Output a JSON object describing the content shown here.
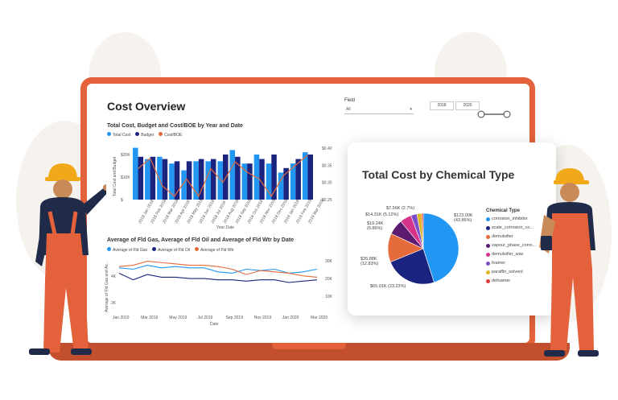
{
  "dashboard": {
    "title": "Cost Overview",
    "filter": {
      "label": "Field",
      "value": "All"
    },
    "year_range": {
      "start": "2018",
      "end": "2020"
    }
  },
  "colors": {
    "laptop": "#e3623b",
    "accent_blue": "#1a73e8",
    "navy": "#1e2a8a",
    "orange": "#e56a3c"
  },
  "chart_data": [
    {
      "type": "bar",
      "title": "Total Cost, Budget and Cost/BOE by Year and Date",
      "xlabel": "Year Date",
      "ylabel": "Total Cost and Budget",
      "legend": [
        "Total Cost",
        "Budget",
        "Cost/BOE"
      ],
      "yticks": [
        "$20K",
        "$10K",
        "$"
      ],
      "y2ticks": [
        "$0.40",
        "$0.35",
        "$0.30",
        "$0.25"
      ],
      "categories": [
        "2018 Jan 2018",
        "2018 Feb 2018",
        "2018 Mar 2018",
        "2018 Apr 2018",
        "2018 May 2018",
        "2018 Jun 2018",
        "2018 Jul 2018",
        "2018 Aug 2018",
        "2018 Sep 2018",
        "2018 Oct 2018",
        "2018 Nov 2018",
        "2018 Dec 2018",
        "2019 Jan 2019",
        "2019 Feb 2019",
        "2019 Mar 2019"
      ],
      "series": [
        {
          "name": "Total Cost",
          "values": [
            23,
            18,
            19,
            16,
            13,
            17,
            17,
            17,
            22,
            16,
            20,
            16,
            12,
            16,
            21
          ]
        },
        {
          "name": "Budget",
          "values": [
            19,
            19,
            18,
            17,
            17,
            18,
            18,
            20,
            19,
            16,
            18,
            20,
            14,
            18,
            20
          ]
        },
        {
          "name": "Cost/BOE",
          "values": [
            0.34,
            0.37,
            0.29,
            0.26,
            0.31,
            0.26,
            0.34,
            0.3,
            0.36,
            0.33,
            0.31,
            0.26,
            0.32,
            0.35,
            0.38
          ]
        }
      ]
    },
    {
      "type": "line",
      "title": "Average of Fld Gas, Average of Fld Oil and Average of Fld Wtr by Date",
      "xlabel": "Date",
      "ylabel": "Average of Fld Gas and Av...",
      "legend": [
        "Average of Fld Gas",
        "Average of Fld Oil",
        "Average of Fld Wtr"
      ],
      "xticks": [
        "Jan 2019",
        "Mar 2019",
        "May 2019",
        "Jul 2019",
        "Sep 2019",
        "Nov 2019",
        "Jan 2020",
        "Mar 2020"
      ],
      "yticks": [
        "4K",
        "2K"
      ],
      "y2ticks": [
        "30K",
        "20K",
        "10K"
      ],
      "series": [
        {
          "name": "Average of Fld Gas",
          "values": [
            4.6,
            4.5,
            4.8,
            4.6,
            4.7,
            4.6,
            4.6,
            4.3,
            4.2,
            4.5,
            4.4,
            4.5,
            4.2,
            4.3,
            4.5
          ]
        },
        {
          "name": "Average of Fld Oil",
          "values": [
            4.2,
            3.7,
            4.1,
            3.9,
            3.9,
            3.8,
            3.8,
            3.7,
            3.7,
            3.6,
            3.7,
            3.7,
            3.5,
            3.6,
            3.7
          ]
        },
        {
          "name": "Average of Fld Wtr",
          "values": [
            4.7,
            4.8,
            5.1,
            5.0,
            4.9,
            4.8,
            4.8,
            4.7,
            4.5,
            4.1,
            4.4,
            4.3,
            4.2,
            4.0,
            3.9
          ]
        }
      ]
    },
    {
      "type": "pie",
      "title": "Total Cost by Chemical Type",
      "legend_title": "Chemical Type",
      "slices": [
        {
          "name": "corrosion_inhibitor",
          "value": 123.0,
          "label": "$123.00K (43.86%)",
          "color": "#2196f3"
        },
        {
          "name": "scale_corrosion_co...",
          "value": 65.01,
          "label": "$65.01K (23.23%)",
          "color": "#1a237e"
        },
        {
          "name": "demulsifier",
          "value": 35.88,
          "label": "$35.88K (12.83%)",
          "color": "#e56a3c"
        },
        {
          "name": "vapour_phase_corro...",
          "value": 19.24,
          "label": "$19.24K (6.86%)",
          "color": "#5c1b6e"
        },
        {
          "name": "demulsifier_wax",
          "value": 14.31,
          "label": "$14.31K (5.12%)",
          "color": "#d6338a"
        },
        {
          "name": "foamer",
          "value": 7.56,
          "label": "$7.56K (2.7%)",
          "color": "#7b4fc9"
        },
        {
          "name": "paraffin_solvent",
          "value": 6.0,
          "label": "",
          "color": "#e0b422"
        },
        {
          "name": "defoamer",
          "value": 2.0,
          "label": "",
          "color": "#e53935"
        }
      ]
    }
  ]
}
